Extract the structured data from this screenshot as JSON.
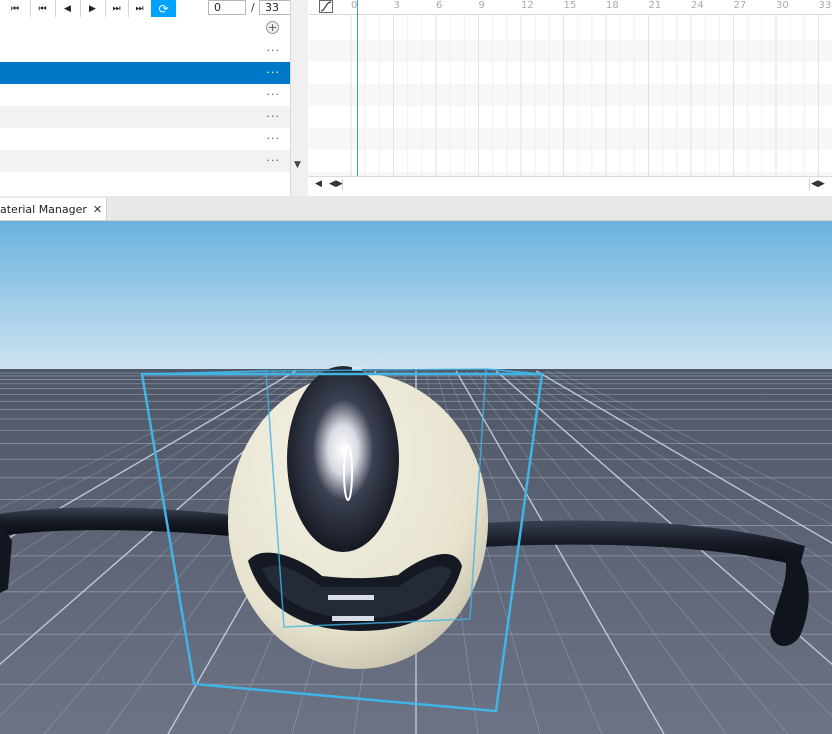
{
  "toolbar": {
    "buttons": [
      {
        "name": "skip-to-start-icon",
        "glyph": "⏮"
      },
      {
        "name": "previous-keyframe-icon",
        "glyph": "⏮"
      },
      {
        "name": "step-back-icon",
        "glyph": "◀"
      },
      {
        "name": "play-icon",
        "glyph": "▶"
      },
      {
        "name": "next-keyframe-icon",
        "glyph": "⏭"
      },
      {
        "name": "skip-to-end-icon",
        "glyph": "⏭"
      },
      {
        "name": "loop-icon",
        "glyph": "⟳"
      }
    ],
    "current_frame": "0",
    "separator": "/",
    "total_frames": "33"
  },
  "track_list": {
    "add_glyph": "+",
    "more_glyph": "···",
    "rows": 7,
    "selected_row": 2
  },
  "timeline": {
    "ticks": [
      "0",
      "3",
      "6",
      "9",
      "12",
      "15",
      "18",
      "21",
      "24",
      "27",
      "30",
      "33"
    ],
    "playhead_frame": 0
  },
  "tabs": [
    {
      "label": "aterial Manager",
      "close_glyph": "✕"
    }
  ],
  "colors": {
    "accent": "#00a2ff",
    "selected_row": "#0078c8",
    "selection_box": "#41b4e6",
    "sky_top": "#6ab2de",
    "sky_bottom": "#cfe4f1",
    "baseplate": "#5f6778"
  }
}
